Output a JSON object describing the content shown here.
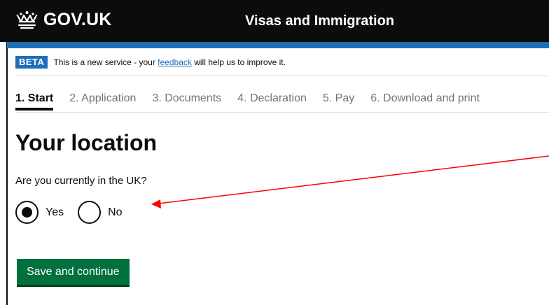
{
  "header": {
    "logo_text": "GOV.UK",
    "service_name": "Visas and Immigration",
    "crown_icon": "crown-icon"
  },
  "beta_banner": {
    "tag": "BETA",
    "text_before": "This is a new service - your",
    "link_text": "feedback",
    "text_after": "will help us to improve it."
  },
  "steps": [
    {
      "label": "1. Start",
      "current": true
    },
    {
      "label": "2. Application",
      "current": false
    },
    {
      "label": "3. Documents",
      "current": false
    },
    {
      "label": "4. Declaration",
      "current": false
    },
    {
      "label": "5. Pay",
      "current": false
    },
    {
      "label": "6. Download and print",
      "current": false
    }
  ],
  "main": {
    "title": "Your location",
    "question": "Are you currently in the UK?",
    "options": [
      {
        "label": "Yes",
        "selected": true
      },
      {
        "label": "No",
        "selected": false
      }
    ],
    "save_button": "Save and continue"
  },
  "colors": {
    "header_background": "#0b0c0c",
    "brand_blue": "#1d70b8",
    "primary_button": "#00703c",
    "annotation_red": "#ff0000"
  }
}
